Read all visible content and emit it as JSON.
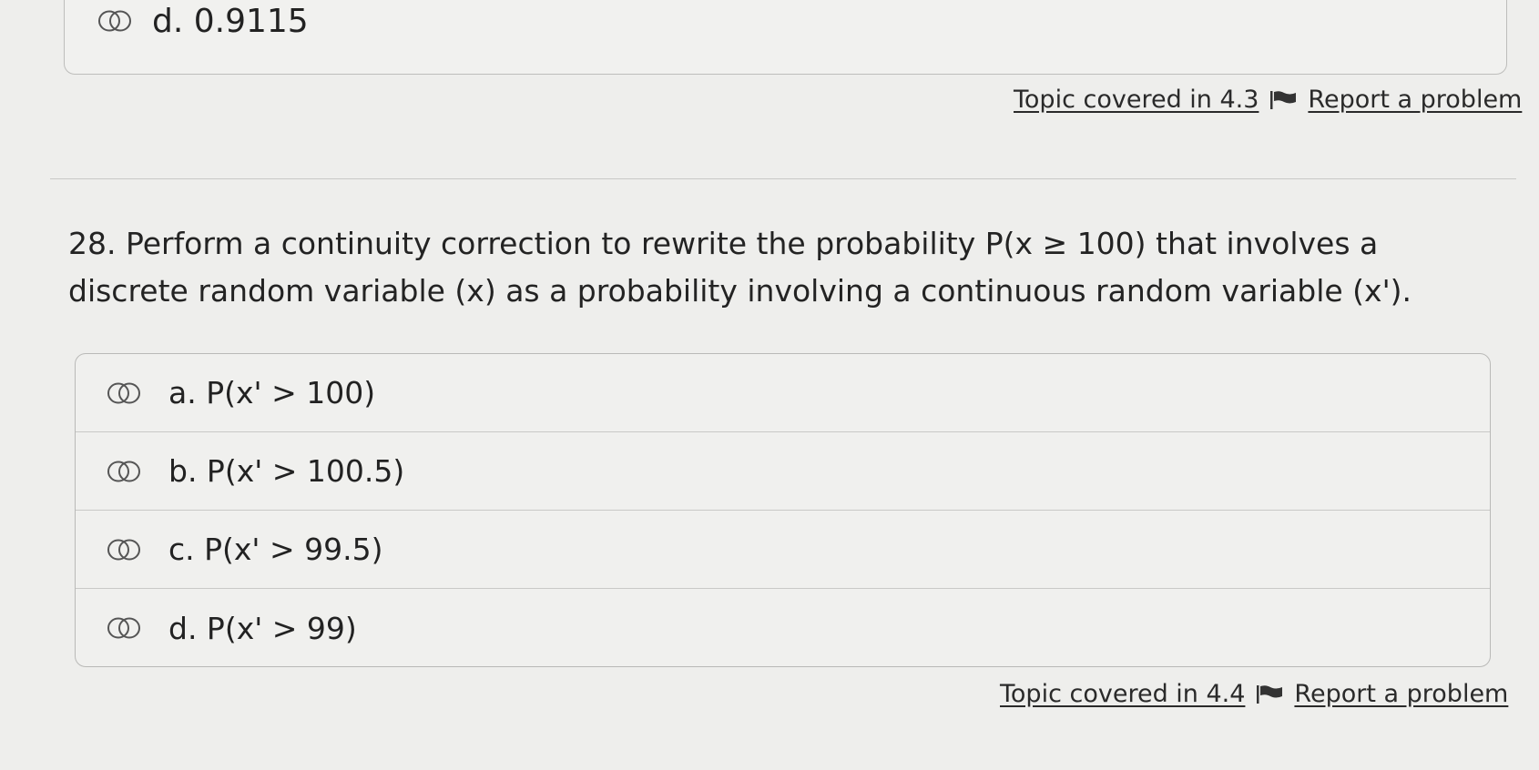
{
  "previous_question": {
    "option_d": "d. 0.9115",
    "topic_link": "Topic covered in 4.3",
    "report_link": "Report a problem"
  },
  "question": {
    "text": "28. Perform a continuity correction to rewrite the probability P(x ≥ 100) that involves a discrete random variable (x) as a probability involving a continuous random variable (x').",
    "options": [
      {
        "label": "a. P(x' > 100)"
      },
      {
        "label": "b. P(x' > 100.5)"
      },
      {
        "label": "c. P(x' > 99.5)"
      },
      {
        "label": "d. P(x' > 99)"
      }
    ],
    "topic_link": "Topic covered in 4.4",
    "report_link": "Report a problem"
  },
  "icons": {
    "radio": "radio-button-icon",
    "flag": "flag-icon"
  }
}
